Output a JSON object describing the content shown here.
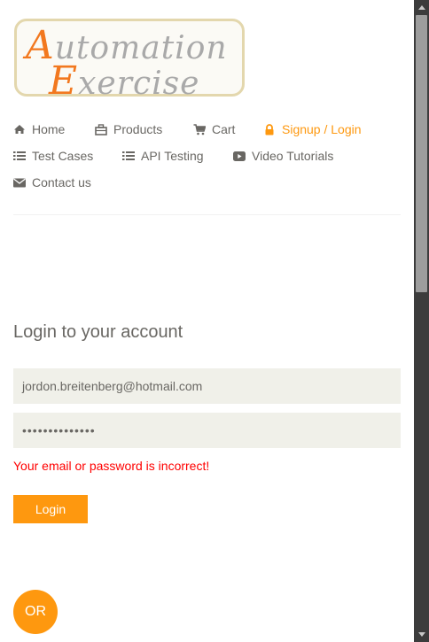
{
  "logo": {
    "line1_cap": "A",
    "line1_rest": "utomation",
    "line2_cap": "E",
    "line2_rest": "xercise"
  },
  "nav": {
    "home": "Home",
    "products": "Products",
    "cart": "Cart",
    "signup_login": "Signup / Login",
    "test_cases": "Test Cases",
    "api_testing": "API Testing",
    "video_tutorials": "Video Tutorials",
    "contact_us": "Contact us"
  },
  "login": {
    "title": "Login to your account",
    "email_value": "jordon.breitenberg@hotmail.com",
    "password_masked": "••••••••••••••",
    "error": "Your email or password is incorrect!",
    "button": "Login"
  },
  "or_label": "OR",
  "colors": {
    "accent": "#fe980f",
    "error": "#ff0000",
    "text": "#696763",
    "input_bg": "#f0f0e9"
  },
  "icons": {
    "home": "home-icon",
    "products": "briefcase-icon",
    "cart": "cart-icon",
    "signup_login": "lock-icon",
    "test_cases": "list-icon",
    "api_testing": "list-icon",
    "video_tutorials": "youtube-play-icon",
    "contact_us": "envelope-icon"
  }
}
